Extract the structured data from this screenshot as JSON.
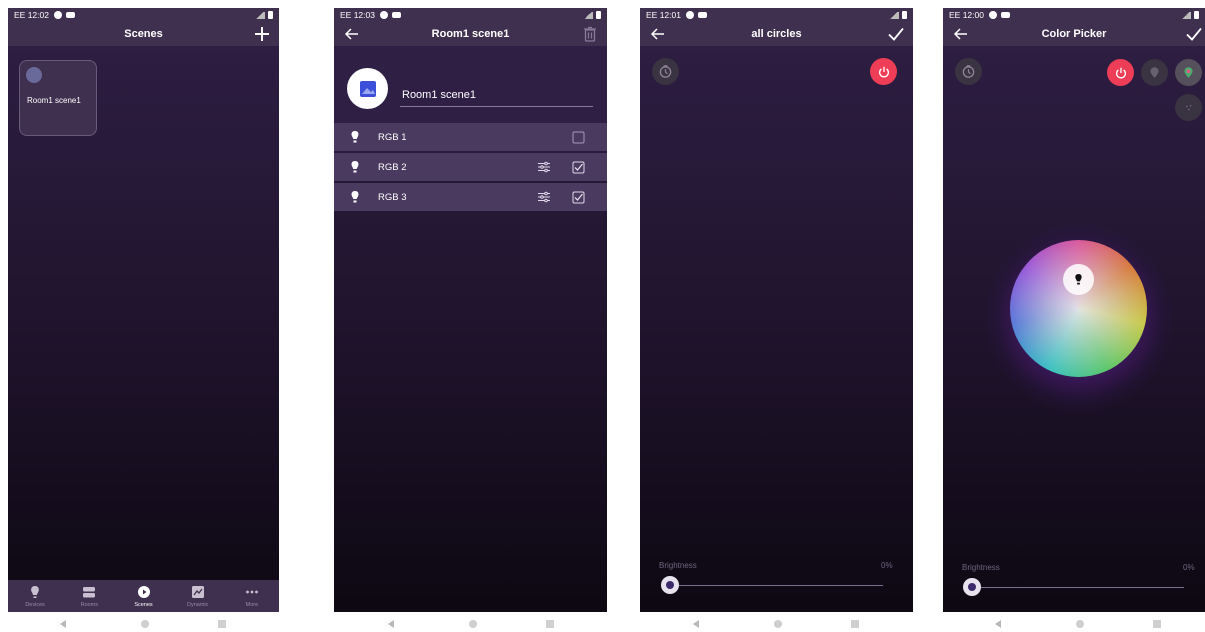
{
  "colors": {
    "bg_top": "#2f1f45",
    "bar": "#40304f",
    "row": "#4a3a5f",
    "power_red": "#ee3d57",
    "timer_gray": "#3a3342"
  },
  "screen1": {
    "status_time": "EE 12:02",
    "title": "Scenes",
    "card_label": "Room1 scene1",
    "nav": [
      {
        "label": "Devices",
        "icon": "bulb-icon"
      },
      {
        "label": "Rooms",
        "icon": "rooms-icon"
      },
      {
        "label": "Scenes",
        "icon": "play-circle-icon"
      },
      {
        "label": "Dynamic",
        "icon": "chart-icon"
      },
      {
        "label": "More",
        "icon": "more-dots-icon"
      }
    ]
  },
  "screen2": {
    "status_time": "EE 12:03",
    "title": "Room1 scene1",
    "name_value": "Room1 scene1",
    "devices": [
      {
        "label": "RGB 1",
        "checked": false
      },
      {
        "label": "RGB 2",
        "checked": true
      },
      {
        "label": "RGB 3",
        "checked": true
      }
    ]
  },
  "screen3": {
    "status_time": "EE 12:01",
    "title": "all circles",
    "brightness_label": "Brightness",
    "brightness_value": "0%",
    "brightness_level": 0
  },
  "screen4": {
    "status_time": "EE 12:00",
    "title": "Color Picker",
    "brightness_label": "Brightness",
    "brightness_value": "0%",
    "brightness_level": 0
  }
}
